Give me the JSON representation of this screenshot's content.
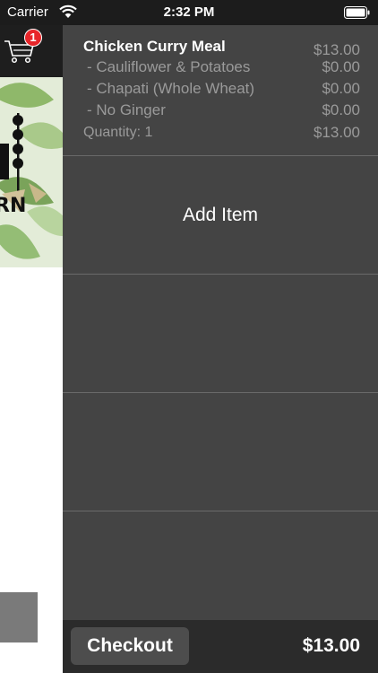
{
  "status_bar": {
    "carrier": "Carrier",
    "time": "2:32 PM",
    "icons": [
      "wifi-icon",
      "battery-icon"
    ]
  },
  "left_screen": {
    "cart_badge_count": "1",
    "icons": [
      "cart-icon"
    ],
    "banner_text": "RN"
  },
  "cart": {
    "items": [
      {
        "name": "Chicken Curry Meal",
        "price": "$13.00",
        "options": [
          {
            "label": "- Cauliflower & Potatoes",
            "price": "$0.00"
          },
          {
            "label": "- Chapati (Whole Wheat)",
            "price": "$0.00"
          },
          {
            "label": "- No Ginger",
            "price": "$0.00"
          }
        ],
        "quantity_label": "Quantity: 1",
        "line_total": "$13.00"
      }
    ],
    "add_item_label": "Add Item",
    "checkout_label": "Checkout",
    "total": "$13.00"
  },
  "colors": {
    "panel_bg": "#444444",
    "footer_bg": "#2b2b2b",
    "secondary_text": "#9a9a9a",
    "badge": "#e8262a"
  }
}
